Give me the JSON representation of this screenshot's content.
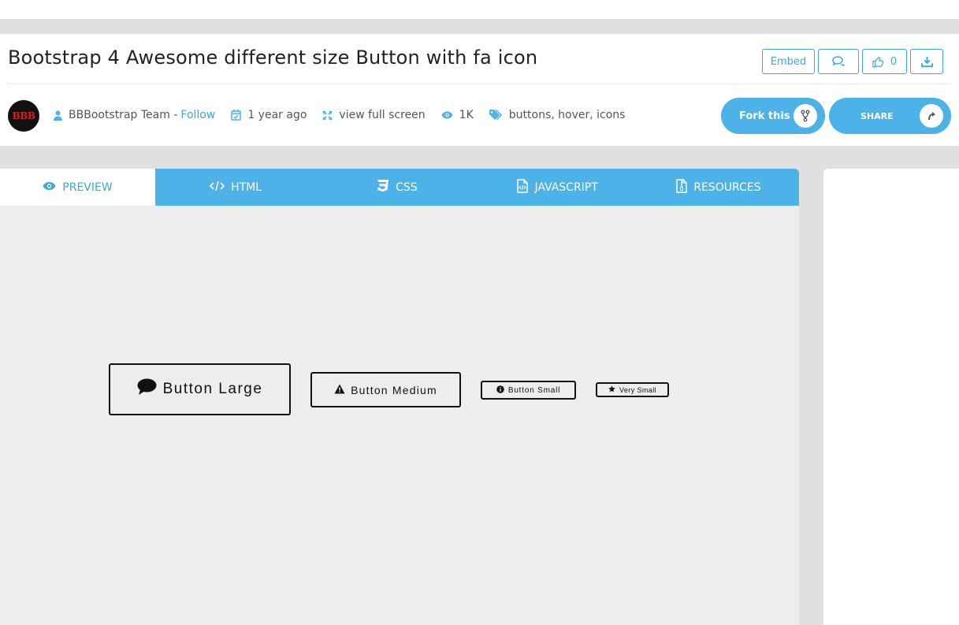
{
  "header": {
    "title": "Bootstrap 4 Awesome different size Button with fa icon",
    "embed_label": "Embed",
    "like_count": "0"
  },
  "meta": {
    "avatar_text": "BBB",
    "author": "BBBootstrap Team -",
    "follow_label": "Follow",
    "time": "1 year ago",
    "fullscreen_label": "view full screen",
    "views": "1K",
    "tags": "buttons, hover, icons"
  },
  "actions": {
    "fork_label": "Fork this",
    "share_label": "SHARE"
  },
  "tabs": [
    {
      "label": "PREVIEW",
      "icon": "eye-icon"
    },
    {
      "label": "HTML",
      "icon": "code-icon"
    },
    {
      "label": "CSS",
      "icon": "css3-icon"
    },
    {
      "label": "JAVASCRIPT",
      "icon": "file-code-icon"
    },
    {
      "label": "RESOURCES",
      "icon": "file-zip-icon"
    }
  ],
  "demo_buttons": [
    {
      "label": "Button Large",
      "icon": "comment-icon"
    },
    {
      "label": "Button Medium",
      "icon": "warning-icon"
    },
    {
      "label": "Button Small",
      "icon": "info-circle-icon"
    },
    {
      "label": "Very Small",
      "icon": "star-icon"
    }
  ],
  "colors": {
    "accent": "#4cb2e8",
    "link": "#39a8dc",
    "preview_bg": "#ededed"
  }
}
